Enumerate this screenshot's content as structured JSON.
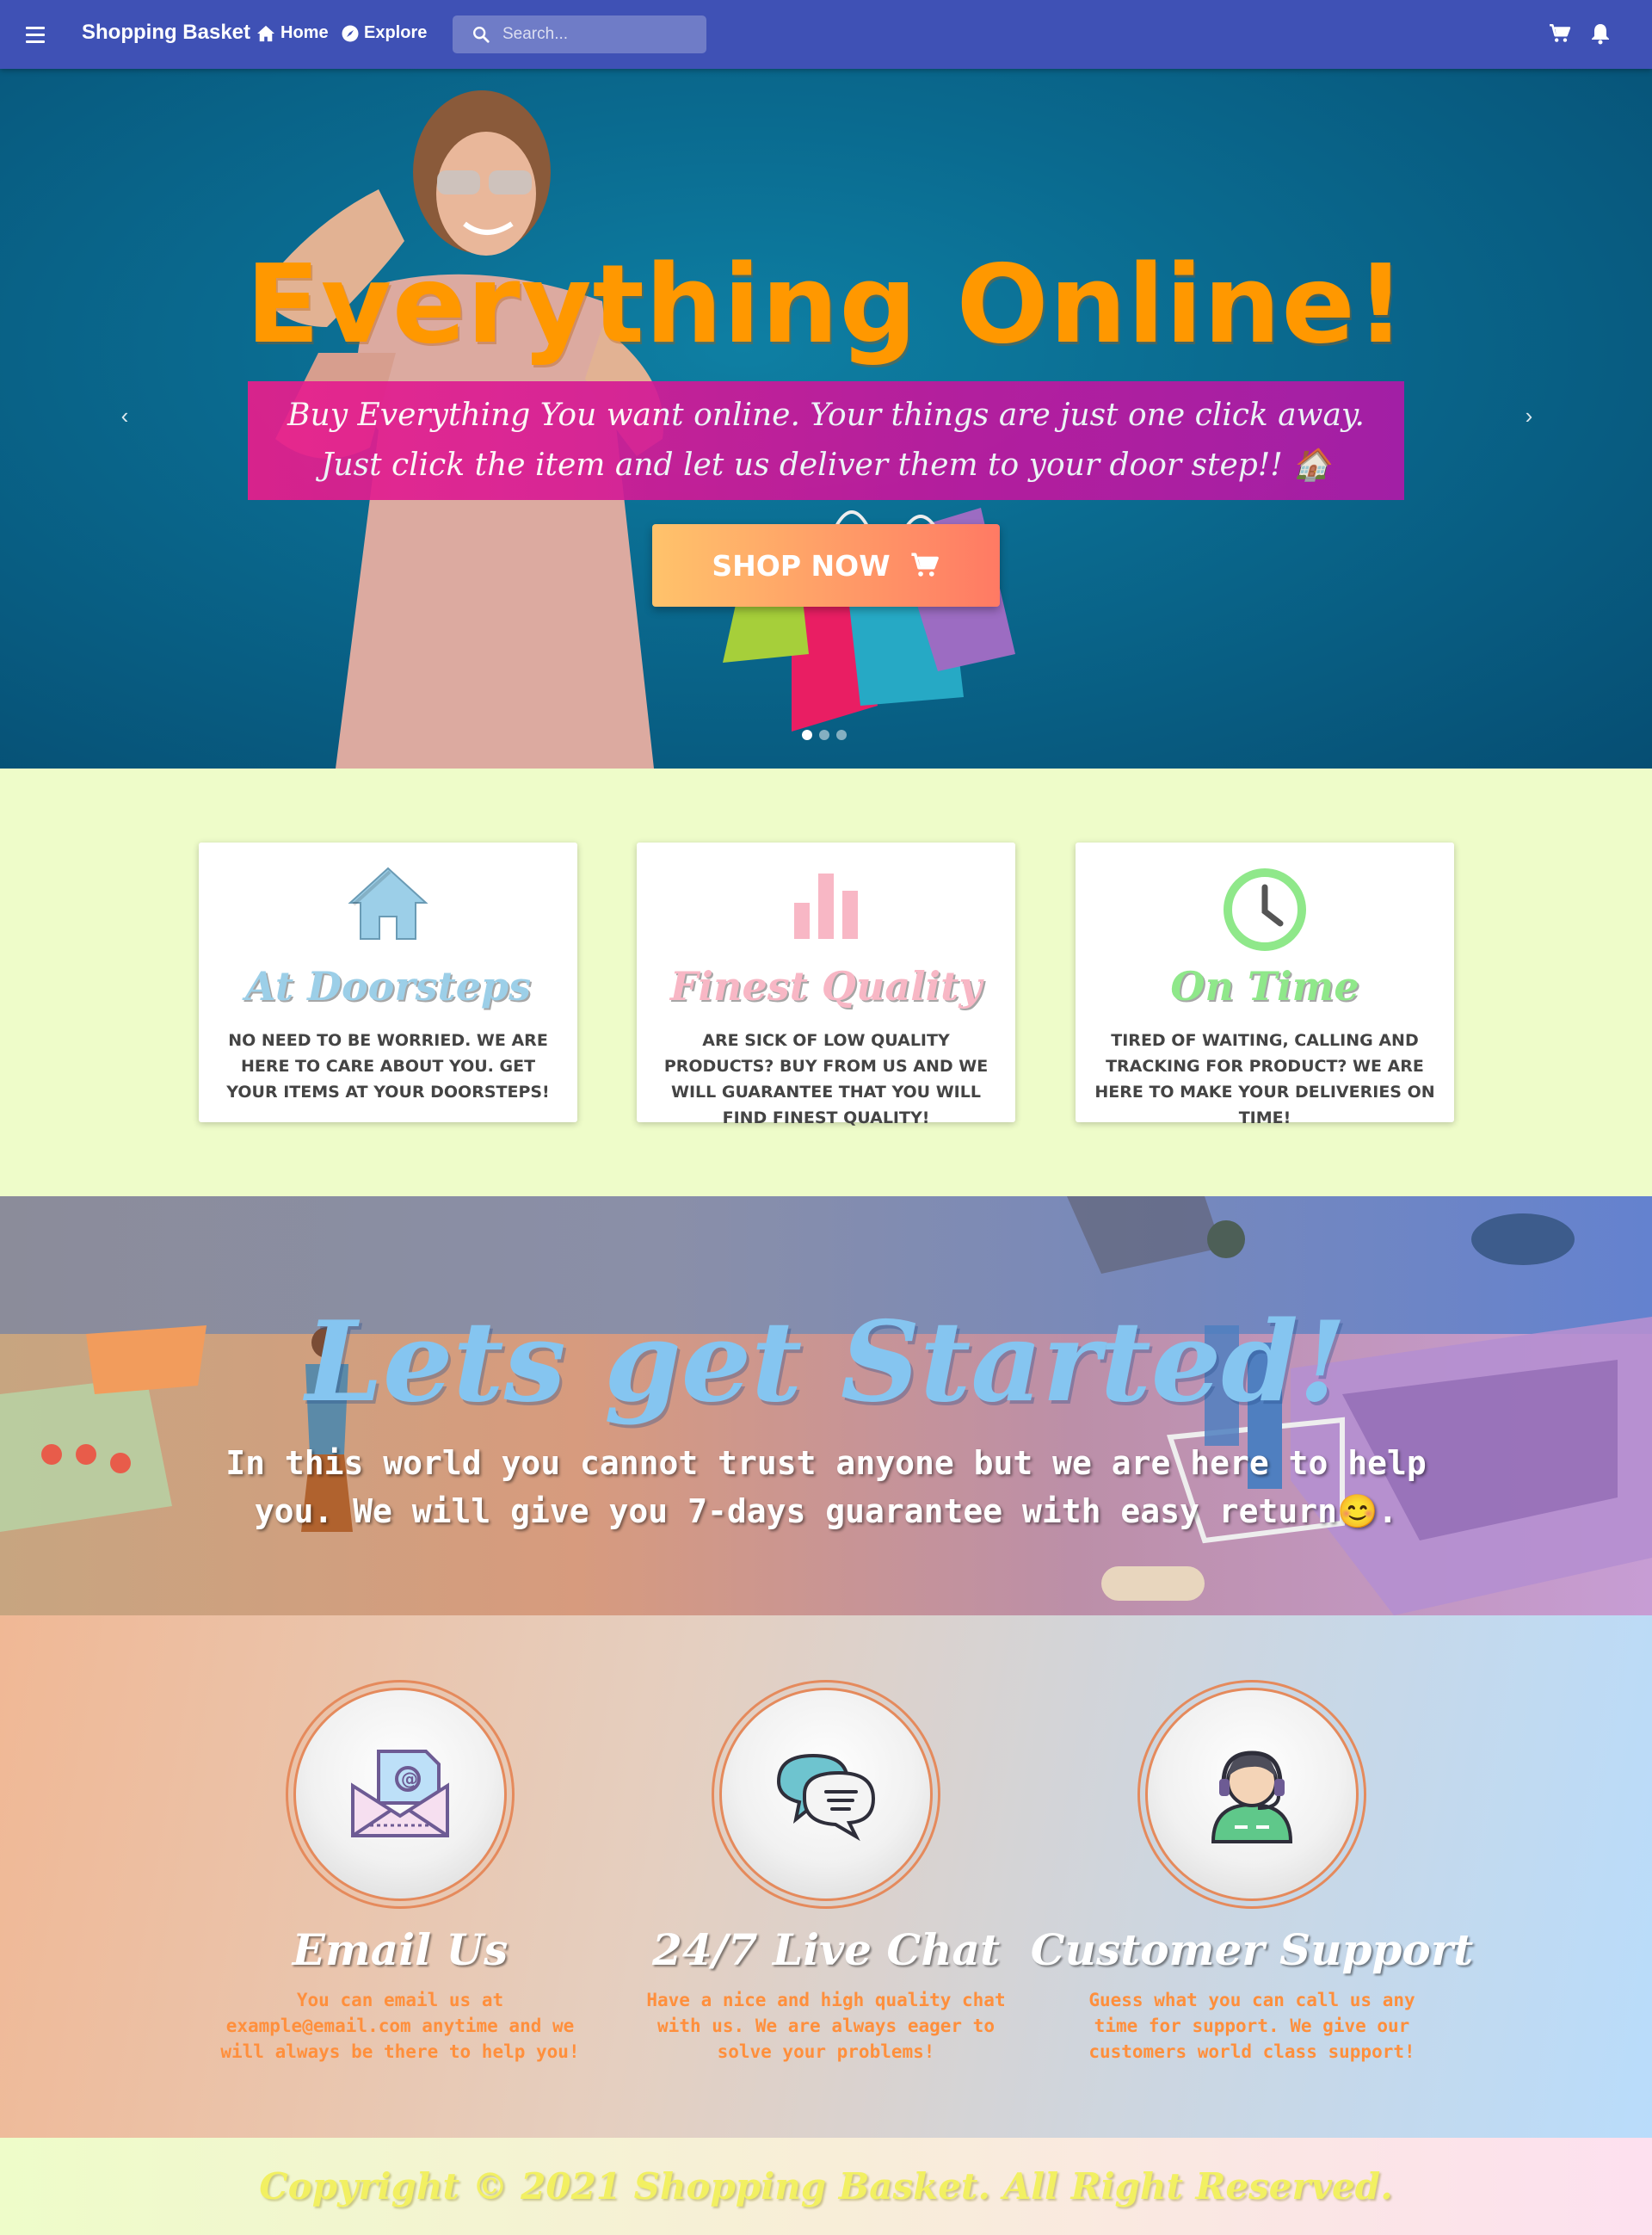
{
  "navbar": {
    "brand": "Shopping Basket",
    "home_label": "Home",
    "explore_label": "Explore",
    "search_placeholder": "Search...",
    "bg_color": "#3f51b5"
  },
  "hero": {
    "title": "Everything Online!",
    "description": "Buy Everything You want online. Your things are just one click away. Just click the item and let us deliver them to your door step!! 🏠",
    "button_label": "SHOP NOW",
    "prev_label": "‹",
    "next_label": "›",
    "slide_count": 3,
    "active_slide": 1
  },
  "features": [
    {
      "icon": "home-icon",
      "title": "At Doorsteps",
      "description": "No need to be worried. We are here to care about you. Get your items at your doorsteps!",
      "color": "#9ccfe8"
    },
    {
      "icon": "bar-chart-icon",
      "title": "Finest Quality",
      "description": "Are sick of low quality products? Buy from us and we will guarantee that you will find finest quality!",
      "color": "#f8b7c5"
    },
    {
      "icon": "clock-icon",
      "title": "On Time",
      "description": "Tired of waiting, calling and tracking for product? We are here to make your deliveries on time!",
      "color": "#8fe88a"
    }
  ],
  "started": {
    "title": "Lets get Started!",
    "description": "In this world you cannot trust anyone but we are here to help you. We will give you 7-days guarantee with easy return😊."
  },
  "contact": [
    {
      "icon": "email-icon",
      "title": "Email Us",
      "description": "You can email us at example@email.com anytime and we will always be there to help you!"
    },
    {
      "icon": "chat-icon",
      "title": "24/7 Live Chat",
      "description": "Have a nice and high quality chat with us. We are always eager to solve your problems!"
    },
    {
      "icon": "support-agent-icon",
      "title": "Customer Support",
      "description": "Guess what you can call us any time for support. We give our customers world class support!"
    }
  ],
  "footer": {
    "text": "Copyright © 2021 Shopping Basket. All Right Reserved."
  }
}
